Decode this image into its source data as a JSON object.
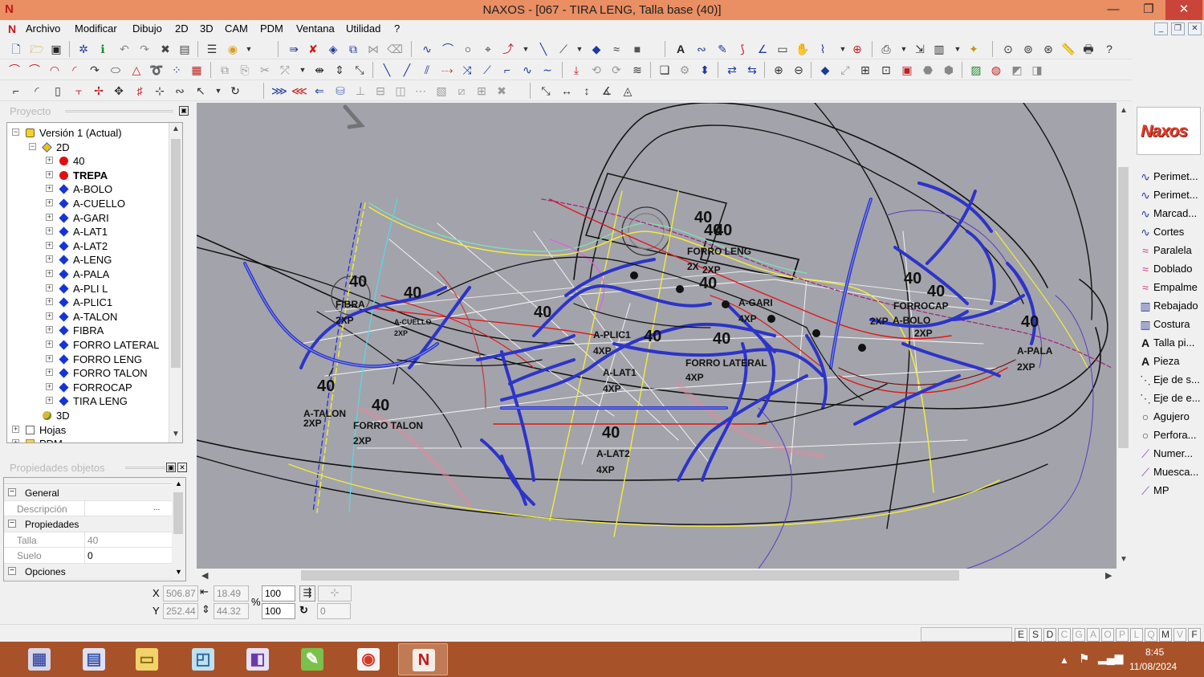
{
  "window": {
    "app_icon": "naxos-n-logo-icon",
    "title": "NAXOS - [067 - TIRA LENG, Talla base (40)]",
    "controls": [
      "minimize-icon",
      "restore-icon",
      "close-icon"
    ]
  },
  "menu": {
    "items": [
      "Archivo",
      "Modificar",
      "Dibujo",
      "2D",
      "3D",
      "CAM",
      "PDM",
      "Ventana",
      "Utilidad",
      "?"
    ]
  },
  "project": {
    "header": "Proyecto",
    "tree": [
      {
        "label": "Versión 1 (Actual)",
        "level": 0,
        "icon": "version-icon",
        "expander": "minus"
      },
      {
        "label": "2D",
        "level": 1,
        "icon": "diamond-yellow-icon",
        "expander": "minus"
      },
      {
        "label": "40",
        "level": 2,
        "icon": "red-dot-icon",
        "expander": "plus"
      },
      {
        "label": "TREPA",
        "level": 2,
        "icon": "red-dot-icon",
        "expander": "plus",
        "bold": true
      },
      {
        "label": "A-BOLO",
        "level": 2,
        "icon": "blue-diamond-icon",
        "expander": "plus"
      },
      {
        "label": "A-CUELLO",
        "level": 2,
        "icon": "blue-diamond-icon",
        "expander": "plus"
      },
      {
        "label": "A-GARI",
        "level": 2,
        "icon": "blue-diamond-icon",
        "expander": "plus"
      },
      {
        "label": "A-LAT1",
        "level": 2,
        "icon": "blue-diamond-icon",
        "expander": "plus"
      },
      {
        "label": "A-LAT2",
        "level": 2,
        "icon": "blue-diamond-icon",
        "expander": "plus"
      },
      {
        "label": "A-LENG",
        "level": 2,
        "icon": "blue-diamond-icon",
        "expander": "plus"
      },
      {
        "label": "A-PALA",
        "level": 2,
        "icon": "blue-diamond-icon",
        "expander": "plus"
      },
      {
        "label": "A-PLI L",
        "level": 2,
        "icon": "blue-diamond-icon",
        "expander": "plus"
      },
      {
        "label": "A-PLIC1",
        "level": 2,
        "icon": "blue-diamond-icon",
        "expander": "plus"
      },
      {
        "label": "A-TALON",
        "level": 2,
        "icon": "blue-diamond-icon",
        "expander": "plus"
      },
      {
        "label": "FIBRA",
        "level": 2,
        "icon": "blue-diamond-icon",
        "expander": "plus"
      },
      {
        "label": "FORRO LATERAL",
        "level": 2,
        "icon": "blue-diamond-icon",
        "expander": "plus"
      },
      {
        "label": "FORRO LENG",
        "level": 2,
        "icon": "blue-diamond-icon",
        "expander": "plus"
      },
      {
        "label": "FORRO TALON",
        "level": 2,
        "icon": "blue-diamond-icon",
        "expander": "plus"
      },
      {
        "label": "FORROCAP",
        "level": 2,
        "icon": "blue-diamond-icon",
        "expander": "plus"
      },
      {
        "label": "TIRA LENG",
        "level": 2,
        "icon": "blue-diamond-icon",
        "expander": "plus"
      },
      {
        "label": "3D",
        "level": 1,
        "icon": "ball-icon",
        "expander": "none"
      },
      {
        "label": "Hojas",
        "level": 0,
        "icon": "sheet-icon",
        "expander": "plus"
      },
      {
        "label": "PDM",
        "level": 0,
        "icon": "folder-icon",
        "expander": "plus"
      }
    ]
  },
  "properties": {
    "header": "Propiedades objetos",
    "rows": [
      {
        "type": "category",
        "name": "General"
      },
      {
        "type": "prop",
        "key": "Descripción",
        "value": "",
        "button": "..."
      },
      {
        "type": "category",
        "name": "Propiedades"
      },
      {
        "type": "prop",
        "key": "Talla",
        "value": "40"
      },
      {
        "type": "prop",
        "key": "Suelo",
        "value": "0",
        "dark": true
      },
      {
        "type": "category",
        "name": "Opciones"
      }
    ]
  },
  "canvas": {
    "labels": [
      {
        "text": "40",
        "size": 20
      },
      {
        "text": "40",
        "size": 20
      },
      {
        "text": "40",
        "size": 20
      },
      {
        "text": "FORRO LENG",
        "size": 12
      },
      {
        "text": "2X",
        "size": 12
      },
      {
        "text": "2XP",
        "size": 12
      },
      {
        "text": "40",
        "size": 20
      },
      {
        "text": "40",
        "size": 20
      },
      {
        "text": "FIBRA",
        "size": 12
      },
      {
        "text": "2XP",
        "size": 12
      },
      {
        "text": "40",
        "size": 20
      },
      {
        "text": "A-CUELLO",
        "size": 9
      },
      {
        "text": "2XP",
        "size": 9
      },
      {
        "text": "40",
        "size": 20
      },
      {
        "text": "A-GARI",
        "size": 12
      },
      {
        "text": "4XP",
        "size": 12
      },
      {
        "text": "A-PLIC1",
        "size": 12
      },
      {
        "text": "4XP",
        "size": 12
      },
      {
        "text": "40",
        "size": 20
      },
      {
        "text": "40",
        "size": 20
      },
      {
        "text": "40",
        "size": 20
      },
      {
        "text": "40",
        "size": 20
      },
      {
        "text": "FORROCAP",
        "size": 12
      },
      {
        "text": "A-BOLO",
        "size": 12
      },
      {
        "text": "2XP",
        "size": 12
      },
      {
        "text": "2XP",
        "size": 12
      },
      {
        "text": "40",
        "size": 20
      },
      {
        "text": "A-PALA",
        "size": 12
      },
      {
        "text": "2XP",
        "size": 12
      },
      {
        "text": "FORRO LATERAL",
        "size": 12
      },
      {
        "text": "4XP",
        "size": 12
      },
      {
        "text": "A-LAT1",
        "size": 12
      },
      {
        "text": "4XP",
        "size": 12
      },
      {
        "text": "40",
        "size": 20
      },
      {
        "text": "A-TALON",
        "size": 12
      },
      {
        "text": "2XP",
        "size": 12
      },
      {
        "text": "40",
        "size": 20
      },
      {
        "text": "FORRO TALON",
        "size": 12
      },
      {
        "text": "2XP",
        "size": 12
      },
      {
        "text": "40",
        "size": 20
      },
      {
        "text": "A-LAT2",
        "size": 12
      },
      {
        "text": "4XP",
        "size": 12
      }
    ]
  },
  "right_panel": {
    "brand": "Naxos",
    "tools": [
      {
        "label": "Perimet...",
        "icon": "curve-icon"
      },
      {
        "label": "Perimet...",
        "icon": "curve-icon"
      },
      {
        "label": "Marcad...",
        "icon": "curve-icon"
      },
      {
        "label": "Cortes",
        "icon": "curve-icon"
      },
      {
        "label": "Paralela",
        "icon": "parallel-curve-icon"
      },
      {
        "label": "Doblado",
        "icon": "parallel-curve-icon"
      },
      {
        "label": "Empalme",
        "icon": "parallel-curve-icon"
      },
      {
        "label": "Rebajado",
        "icon": "striped-icon"
      },
      {
        "label": "Costura",
        "icon": "striped-icon"
      },
      {
        "label": "Talla pi...",
        "icon": "letter-a-icon"
      },
      {
        "label": "Pieza",
        "icon": "letter-a-icon"
      },
      {
        "label": "Eje de s...",
        "icon": "dotted-line-icon"
      },
      {
        "label": "Eje de e...",
        "icon": "dotted-line-icon"
      },
      {
        "label": "Agujero",
        "icon": "circle-icon"
      },
      {
        "label": "Perfora...",
        "icon": "circle-icon"
      },
      {
        "label": "Numer...",
        "icon": "pen-curve-icon"
      },
      {
        "label": "Muesca...",
        "icon": "pen-curve-icon"
      },
      {
        "label": "MP",
        "icon": "pen-curve-icon"
      }
    ]
  },
  "coords": {
    "x_label": "X",
    "y_label": "Y",
    "x_value": "506.87",
    "y_value": "252.44",
    "width_value": "18.49",
    "height_value": "44.32",
    "percent_label": "%",
    "scale_x": "100",
    "scale_y": "100",
    "rotation_value": "0"
  },
  "status": {
    "flags": [
      "E",
      "S",
      "D",
      "C",
      "G",
      "A",
      "O",
      "P",
      "L",
      "Q",
      "M",
      "V",
      "F"
    ],
    "flags_on": [
      "E",
      "S",
      "D",
      "M",
      "F"
    ]
  },
  "taskbar": {
    "apps": [
      "calculator-icon",
      "file-explorer-tools-icon",
      "folder-icon",
      "notes-icon",
      "inkscape-like-icon",
      "green-app-icon",
      "chrome-icon",
      "naxos-icon"
    ],
    "time": "8:45",
    "date": "11/08/2024"
  },
  "colors": {
    "titlebar": "#e98f63",
    "canvas_bg": "#a3a3ab",
    "taskbar": "#a8522a",
    "accent_blue": "#2c34c8"
  }
}
